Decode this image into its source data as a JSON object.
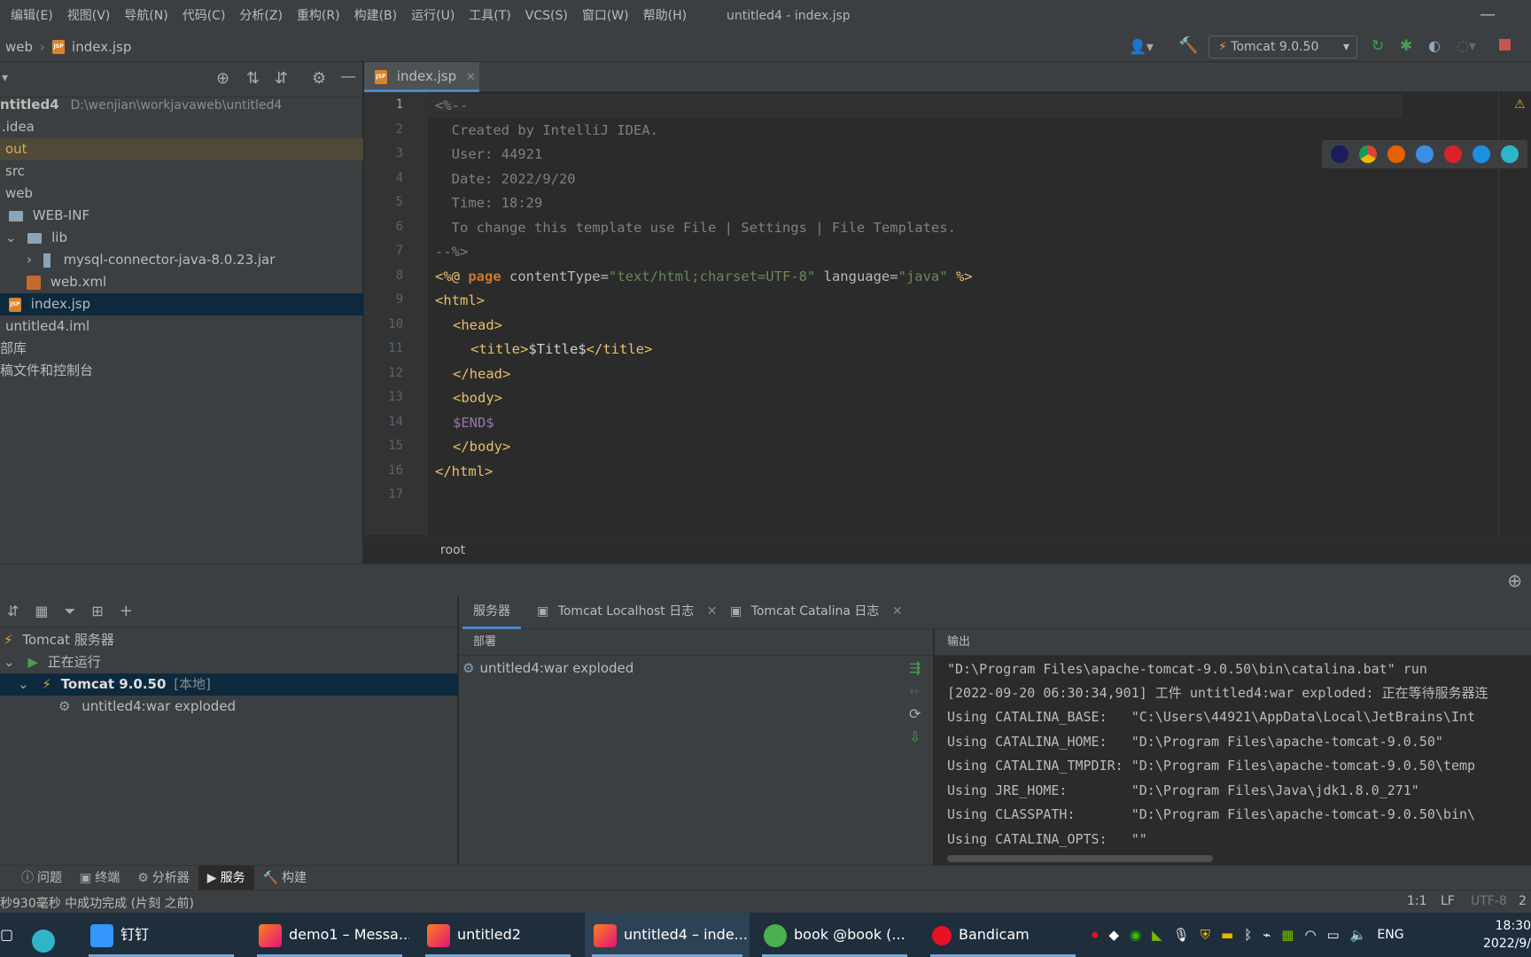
{
  "menubar": {
    "items": [
      "编辑(E)",
      "视图(V)",
      "导航(N)",
      "代码(C)",
      "分析(Z)",
      "重构(R)",
      "构建(B)",
      "运行(U)",
      "工具(T)",
      "VCS(S)",
      "窗口(W)",
      "帮助(H)"
    ],
    "window_title": "untitled4 - index.jsp",
    "minimize": "—"
  },
  "navbar": {
    "crumb_web": "web",
    "crumb_file": "index.jsp",
    "run_config": "Tomcat 9.0.50"
  },
  "project_tree": {
    "root_name": "ntitled4",
    "root_path": "D:\\wenjian\\workjavaweb\\untitled4",
    "items": [
      {
        "label": ".idea"
      },
      {
        "label": "out"
      },
      {
        "label": "src"
      },
      {
        "label": "web"
      },
      {
        "label": "WEB-INF"
      },
      {
        "label": "lib"
      },
      {
        "label": "mysql-connector-java-8.0.23.jar"
      },
      {
        "label": "web.xml"
      },
      {
        "label": "index.jsp"
      },
      {
        "label": "untitled4.iml"
      },
      {
        "label": "部库"
      },
      {
        "label": "稿文件和控制台"
      }
    ]
  },
  "editor": {
    "tab_label": "index.jsp",
    "line_numbers": [
      "1",
      "2",
      "3",
      "4",
      "5",
      "6",
      "7",
      "8",
      "9",
      "10",
      "11",
      "12",
      "13",
      "14",
      "15",
      "16",
      "17"
    ],
    "code": {
      "l1": "<%--",
      "l2": "  Created by IntelliJ IDEA.",
      "l3": "  User: 44921",
      "l4": "  Date: 2022/9/20",
      "l5": "  Time: 18:29",
      "l6": "  To change this template use File | Settings | File Templates.",
      "l7": "--%>",
      "l8_open": "<%@ ",
      "l8_kw": "page",
      "l8_attr1": " contentType=",
      "l8_val1": "\"text/html;charset=UTF-8\"",
      "l8_attr2": " language=",
      "l8_val2": "\"java\"",
      "l8_close": " %>",
      "l9": "<html>",
      "l10": "<head>",
      "l11_open": "<title>",
      "l11_var": "$Title$",
      "l11_close": "</title>",
      "l12": "</head>",
      "l13": "<body>",
      "l14": "$END$",
      "l15": "</body>",
      "l16": "</html>"
    },
    "breadcrumb": "root"
  },
  "services": {
    "tree": {
      "server": "Tomcat 服务器",
      "running": "正在运行",
      "instance_name": "Tomcat 9.0.50",
      "instance_tag": "[本地]",
      "artifact": "untitled4:war exploded"
    },
    "tabs": [
      "服务器",
      "Tomcat Localhost 日志",
      "Tomcat Catalina 日志"
    ],
    "deploy_header": "部署",
    "deploy_item": "untitled4:war exploded",
    "output_header": "输出",
    "output_lines": [
      "\"D:\\Program Files\\apache-tomcat-9.0.50\\bin\\catalina.bat\" run",
      "[2022-09-20 06:30:34,901] 工件 untitled4:war exploded: 正在等待服务器连",
      "Using CATALINA_BASE:   \"C:\\Users\\44921\\AppData\\Local\\JetBrains\\Int",
      "Using CATALINA_HOME:   \"D:\\Program Files\\apache-tomcat-9.0.50\"",
      "Using CATALINA_TMPDIR: \"D:\\Program Files\\apache-tomcat-9.0.50\\temp",
      "Using JRE_HOME:        \"D:\\Program Files\\Java\\jdk1.8.0_271\"",
      "Using CLASSPATH:       \"D:\\Program Files\\apache-tomcat-9.0.50\\bin\\",
      "Using CATALINA_OPTS:   \"\""
    ]
  },
  "toolbar_bottom": {
    "items": [
      "问题",
      "终端",
      "分析器",
      "服务",
      "构建"
    ]
  },
  "status_bar": {
    "message": "秒930毫秒 中成功完成 (片刻 之前)",
    "position": "1:1",
    "line_sep": "LF",
    "encoding": "UTF-8",
    "indent": "2"
  },
  "taskbar": {
    "apps": [
      {
        "label": "钉钉"
      },
      {
        "label": "demo1 – Messa..."
      },
      {
        "label": "untitled2"
      },
      {
        "label": "untitled4 – inde..."
      },
      {
        "label": "book @book (..."
      },
      {
        "label": "Bandicam"
      }
    ],
    "lang": "ENG",
    "time": "18:30",
    "date": "2022/9/"
  },
  "colors": {
    "accent": "#4a88c7",
    "selection": "#0d293e",
    "panel_bg": "#3c3f41",
    "editor_bg": "#2b2b2b",
    "run_green": "#499c54",
    "stop_red": "#c75450"
  }
}
